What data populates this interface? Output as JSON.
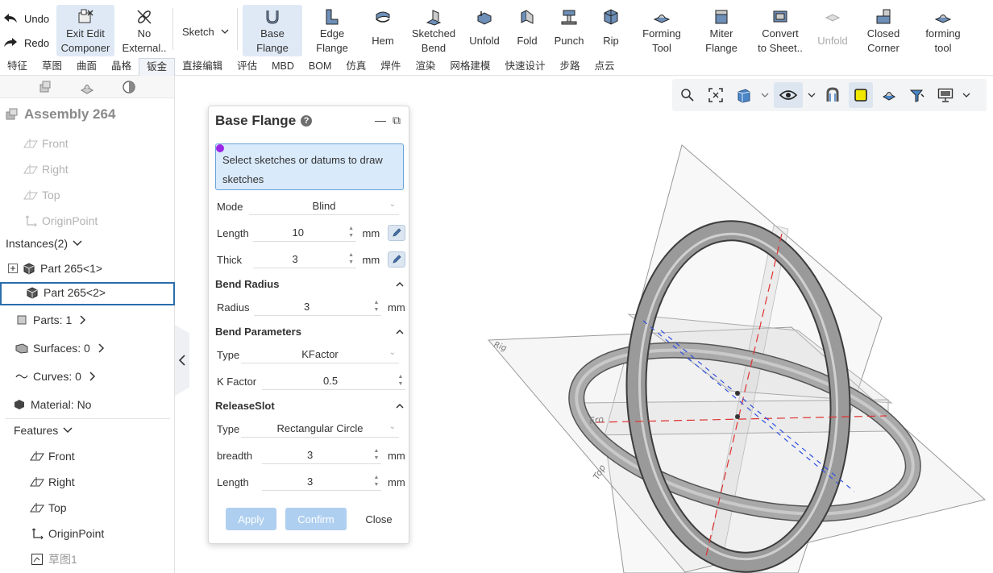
{
  "toolbar": {
    "undo": "Undo",
    "redo": "Redo",
    "exit_edit": "Exit Edit\nComponer",
    "no_external": "No\nExternal..",
    "sketch": "Sketch",
    "base_flange": "Base\nFlange",
    "edge_flange": "Edge\nFlange",
    "hem": "Hem",
    "sketched_bend": "Sketched\nBend",
    "unfold": "Unfold",
    "fold": "Fold",
    "punch": "Punch",
    "rip": "Rip",
    "forming_tool": "Forming\nTool",
    "miter_flange": "Miter\nFlange",
    "convert_to_sheet": "Convert\nto Sheet..",
    "unfold_disabled": "Unfold",
    "closed_corner": "Closed\nCorner",
    "forming_tool_lower": "forming\ntool"
  },
  "menu": [
    "特征",
    "草图",
    "曲面",
    "晶格",
    "钣金",
    "直接编辑",
    "评估",
    "MBD",
    "BOM",
    "仿真",
    "焊件",
    "渲染",
    "网格建模",
    "快速设计",
    "步路",
    "点云"
  ],
  "menu_active": "钣金",
  "tree": {
    "assembly": "Assembly 264",
    "ref_front": "Front",
    "ref_right": "Right",
    "ref_top": "Top",
    "ref_origin": "OriginPoint",
    "instances": "Instances(2)",
    "part1": "Part 265<1>",
    "part2": "Part 265<2>",
    "parts": "Parts: 1",
    "surfaces": "Surfaces: 0",
    "curves": "Curves: 0",
    "material": "Material: No",
    "features": "Features",
    "f_front": "Front",
    "f_right": "Right",
    "f_top": "Top",
    "f_origin": "OriginPoint",
    "f_sketch": "草图1"
  },
  "dialog": {
    "title": "Base Flange",
    "help": "?",
    "minimize": "—",
    "restore": "⧉",
    "selection_prompt": "Select sketches or datums to draw sketches",
    "mode_label": "Mode",
    "mode_value": "Blind",
    "length_label": "Length",
    "length_value": "10",
    "thick_label": "Thick",
    "thick_value": "3",
    "unit": "mm",
    "bend_radius_section": "Bend Radius",
    "radius_label": "Radius",
    "radius_value": "3",
    "bend_params_section": "Bend Parameters",
    "type_label": "Type",
    "type_value": "KFactor",
    "kfactor_label": "K Factor",
    "kfactor_value": "0.5",
    "release_section": "ReleaseSlot",
    "release_type_label": "Type",
    "release_type_value": "Rectangular Circle",
    "breadth_label": "breadth",
    "breadth_value": "3",
    "release_length_label": "Length",
    "release_length_value": "3",
    "apply": "Apply",
    "confirm": "Confirm",
    "close": "Close"
  },
  "viewport": {
    "plane_label_front": "Fro",
    "plane_label_top": "Top",
    "plane_label_right": "Rig"
  },
  "colors": {
    "accent": "#2b6dad",
    "primary_button": "#aecff0",
    "selection_bg": "#d9eafb",
    "selection_marker": "#9b27e5",
    "ring_fill": "#9a9a9a",
    "axis_red": "#e03030",
    "axis_blue": "#3050e0"
  }
}
